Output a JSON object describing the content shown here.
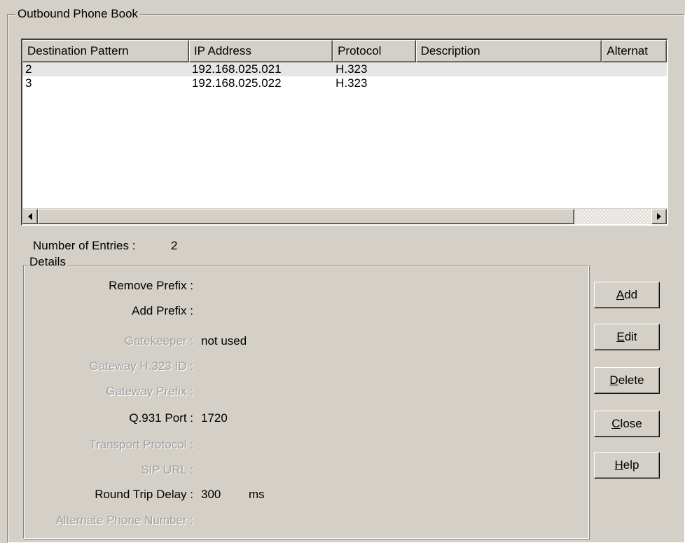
{
  "phonebook": {
    "title": "Outbound Phone Book",
    "columns": [
      "Destination Pattern",
      "IP Address",
      "Protocol",
      "Description",
      "Alternat"
    ],
    "rows": [
      {
        "destination": "2",
        "ip": "192.168.025.021",
        "protocol": "H.323",
        "description": "",
        "alternate": ""
      },
      {
        "destination": "3",
        "ip": "192.168.025.022",
        "protocol": "H.323",
        "description": "",
        "alternate": ""
      }
    ],
    "scroll_left_icon": "arrow-left",
    "scroll_right_icon": "arrow-right",
    "entries_label": "Number of Entries :",
    "entries_count": "2"
  },
  "details": {
    "title": "Details",
    "remove_prefix_label": "Remove Prefix :",
    "add_prefix_label": "Add Prefix :",
    "gatekeeper_label": "Gatekeeper :",
    "gatekeeper_value": "not used",
    "gateway_h323_label": "Gateway H.323 ID :",
    "gateway_prefix_label": "Gateway Prefix :",
    "q931_label": "Q.931 Port :",
    "q931_value": "1720",
    "transport_label": "Transport Protocol :",
    "sip_url_label": "SIP URL :",
    "rtd_label": "Round Trip Delay :",
    "rtd_value": "300",
    "rtd_unit": "ms",
    "alternate_label": "Alternate Phone Number :"
  },
  "buttons": {
    "add": {
      "mnemonic": "A",
      "rest": "dd"
    },
    "edit": {
      "mnemonic": "E",
      "rest": "dit"
    },
    "delete": {
      "mnemonic": "D",
      "rest": "elete"
    },
    "close": {
      "mnemonic": "C",
      "rest": "lose"
    },
    "help": {
      "mnemonic": "H",
      "rest": "elp"
    }
  }
}
